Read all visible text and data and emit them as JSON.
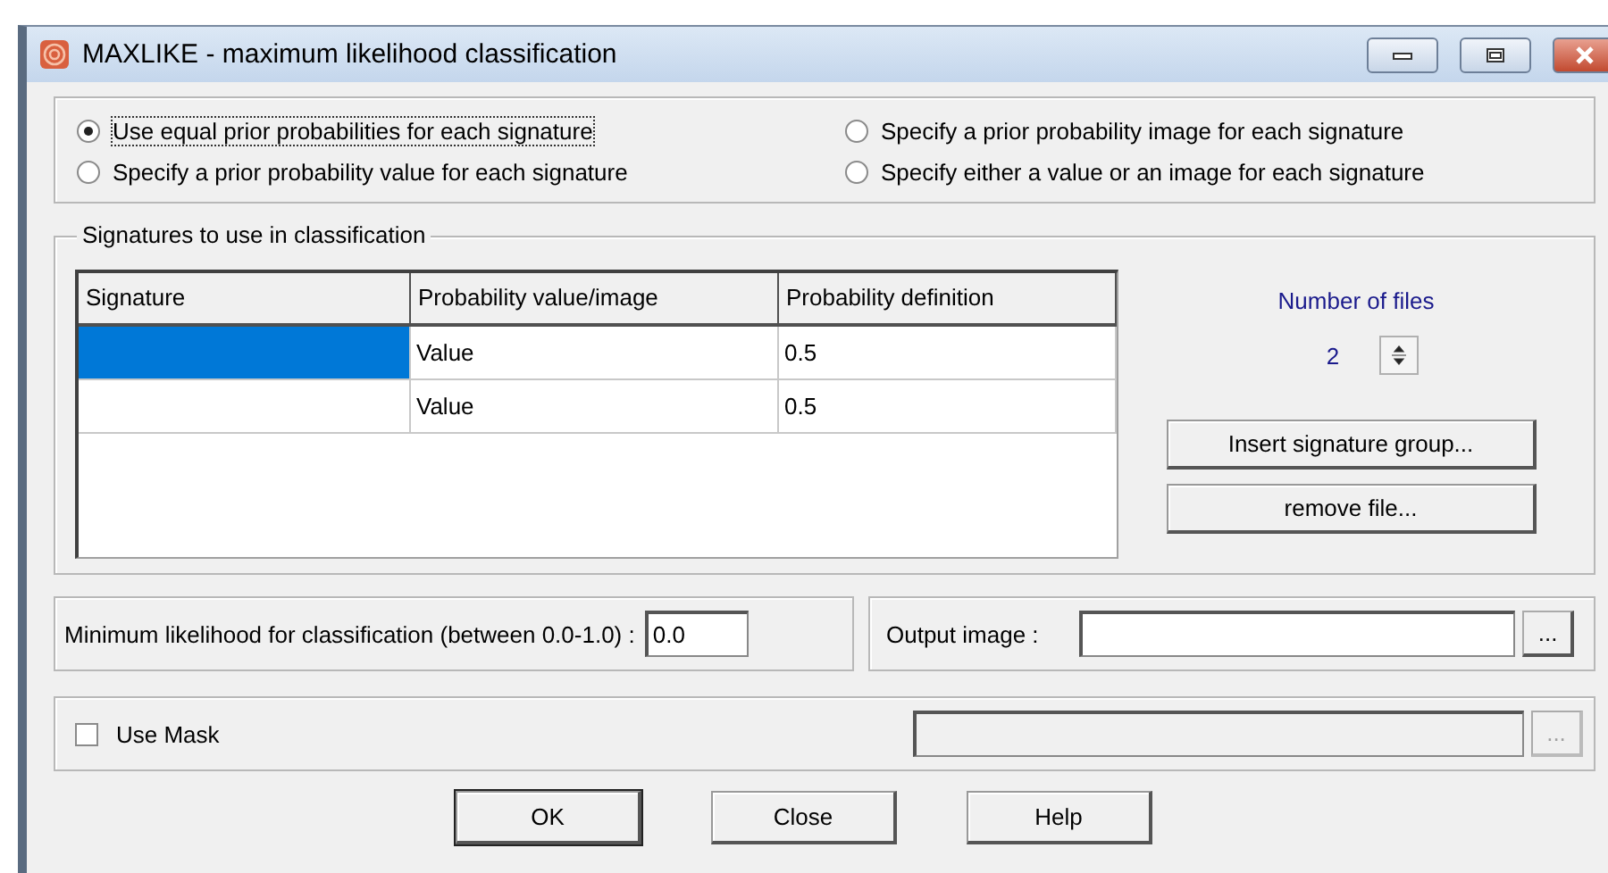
{
  "window": {
    "title": "MAXLIKE - maximum likelihood classification"
  },
  "prior_options": [
    {
      "label": "Use equal prior probabilities for each signature",
      "selected": true
    },
    {
      "label": "Specify a prior probability value for each signature",
      "selected": false
    },
    {
      "label": "Specify a prior probability image for each signature",
      "selected": false
    },
    {
      "label": "Specify either a value or an image for each signature",
      "selected": false
    }
  ],
  "signatures": {
    "title": "Signatures to use in classification",
    "columns": [
      "Signature",
      "Probability value/image",
      "Probability definition"
    ],
    "rows": [
      {
        "cells": [
          "",
          "Value",
          "0.5"
        ],
        "selected": true
      },
      {
        "cells": [
          "",
          "Value",
          "0.5"
        ],
        "selected": false
      }
    ],
    "number_of_files_label": "Number of files",
    "number_of_files": "2",
    "buttons": [
      "Insert signature group...",
      "remove file..."
    ]
  },
  "min_likelihood": {
    "label": "Minimum likelihood for classification (between 0.0-1.0) :",
    "value": "0.0"
  },
  "output_image": {
    "label": "Output image :",
    "browse": "..."
  },
  "mask": {
    "label": "Use Mask",
    "checked": false,
    "disabled": true,
    "browse": "..."
  },
  "buttons": [
    {
      "label": "OK",
      "default": true
    },
    {
      "label": "Close",
      "default": false
    },
    {
      "label": "Help",
      "default": false
    }
  ]
}
